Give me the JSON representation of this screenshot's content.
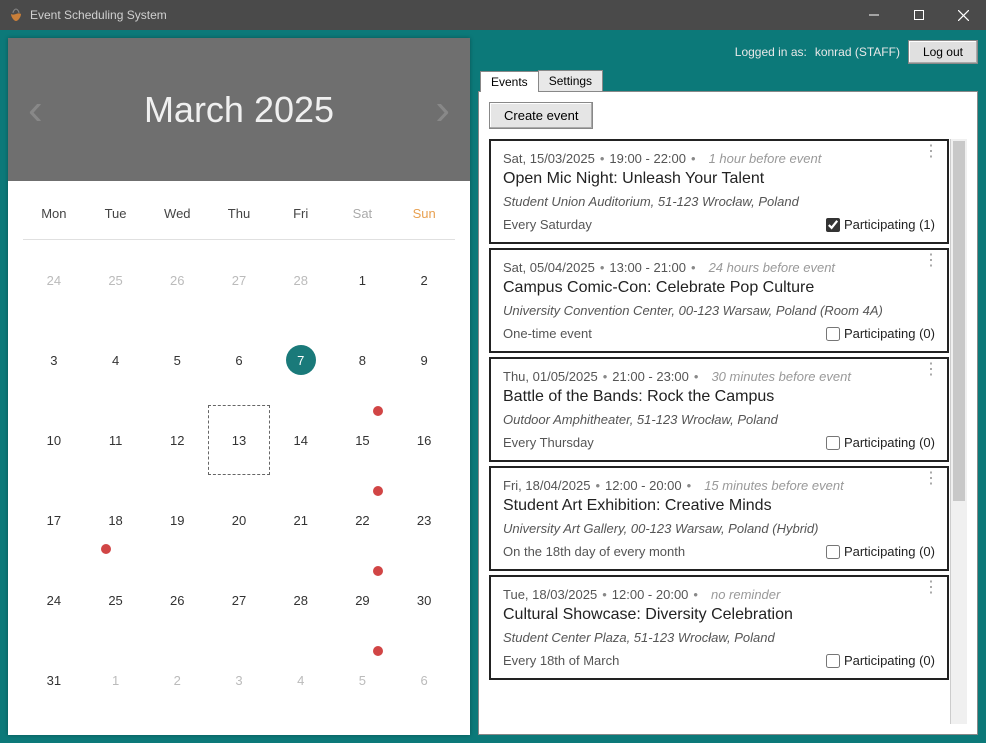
{
  "window": {
    "title": "Event Scheduling System"
  },
  "user": {
    "logged_in_label": "Logged in as:",
    "name": "konrad (STAFF)",
    "logout": "Log out"
  },
  "tabs": {
    "events": "Events",
    "settings": "Settings"
  },
  "calendar": {
    "title": "March 2025",
    "dow": [
      "Mon",
      "Tue",
      "Wed",
      "Thu",
      "Fri",
      "Sat",
      "Sun"
    ],
    "cells": [
      {
        "n": 24,
        "other": true
      },
      {
        "n": 25,
        "other": true
      },
      {
        "n": 26,
        "other": true
      },
      {
        "n": 27,
        "other": true
      },
      {
        "n": 28,
        "other": true
      },
      {
        "n": 1
      },
      {
        "n": 2
      },
      {
        "n": 3
      },
      {
        "n": 4
      },
      {
        "n": 5
      },
      {
        "n": 6
      },
      {
        "n": 7,
        "today": true
      },
      {
        "n": 8
      },
      {
        "n": 9
      },
      {
        "n": 10
      },
      {
        "n": 11
      },
      {
        "n": 12
      },
      {
        "n": 13,
        "sel": true
      },
      {
        "n": 14
      },
      {
        "n": 15,
        "dot": "topright"
      },
      {
        "n": 16
      },
      {
        "n": 17
      },
      {
        "n": 18,
        "dot": "botleft"
      },
      {
        "n": 19
      },
      {
        "n": 20
      },
      {
        "n": 21
      },
      {
        "n": 22,
        "dot": "topright"
      },
      {
        "n": 23
      },
      {
        "n": 24
      },
      {
        "n": 25
      },
      {
        "n": 26
      },
      {
        "n": 27
      },
      {
        "n": 28
      },
      {
        "n": 29,
        "dot": "topright"
      },
      {
        "n": 30
      },
      {
        "n": 31
      },
      {
        "n": 1,
        "other": true
      },
      {
        "n": 2,
        "other": true
      },
      {
        "n": 3,
        "other": true
      },
      {
        "n": 4,
        "other": true
      },
      {
        "n": 5,
        "other": true,
        "dot": "topright"
      },
      {
        "n": 6,
        "other": true
      }
    ]
  },
  "create_label": "Create event",
  "events": [
    {
      "date": "Sat, 15/03/2025",
      "time": "19:00 - 22:00",
      "reminder": "1 hour before event",
      "title": "Open Mic Night: Unleash Your Talent",
      "loc": "Student Union Auditorium, 51-123 Wrocław, Poland",
      "recur": "Every Saturday",
      "checked": true,
      "count": 1
    },
    {
      "date": "Sat, 05/04/2025",
      "time": "13:00 - 21:00",
      "reminder": "24 hours before event",
      "title": "Campus Comic-Con: Celebrate Pop Culture",
      "loc": "University Convention Center, 00-123 Warsaw, Poland (Room 4A)",
      "recur": "One-time event",
      "checked": false,
      "count": 0
    },
    {
      "date": "Thu, 01/05/2025",
      "time": "21:00 - 23:00",
      "reminder": "30 minutes before event",
      "title": "Battle of the Bands: Rock the Campus",
      "loc": "Outdoor Amphitheater, 51-123 Wrocław, Poland",
      "recur": "Every Thursday",
      "checked": false,
      "count": 0
    },
    {
      "date": "Fri, 18/04/2025",
      "time": "12:00 - 20:00",
      "reminder": "15 minutes before event",
      "title": "Student Art Exhibition: Creative Minds",
      "loc": "University Art Gallery, 00-123 Warsaw, Poland (Hybrid)",
      "recur": "On the 18th day of every month",
      "checked": false,
      "count": 0
    },
    {
      "date": "Tue, 18/03/2025",
      "time": "12:00 - 20:00",
      "reminder": "no reminder",
      "title": "Cultural Showcase: Diversity Celebration",
      "loc": "Student Center Plaza, 51-123 Wrocław, Poland",
      "recur": "Every 18th of March",
      "checked": false,
      "count": 0
    }
  ],
  "participating_label": "Participating"
}
